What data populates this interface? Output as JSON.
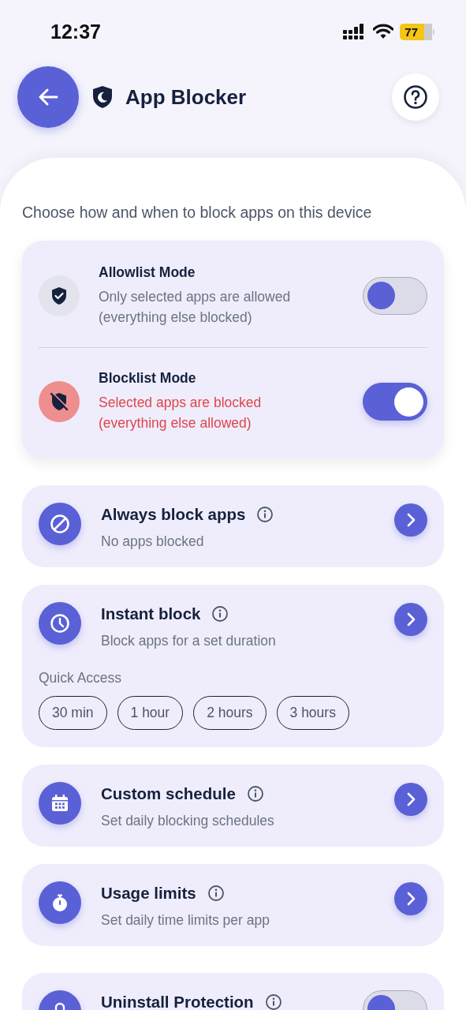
{
  "status_bar": {
    "time": "12:37",
    "battery": "77"
  },
  "header": {
    "title": "App Blocker"
  },
  "intro": "Choose how and when to block apps on this device",
  "modes": [
    {
      "kind": "allow",
      "title": "Allowlist Mode",
      "description": "Only selected apps are allowed (everything else blocked)",
      "on": false
    },
    {
      "kind": "block",
      "title": "Blocklist Mode",
      "description": "Selected apps are blocked (everything else allowed)",
      "on": true
    }
  ],
  "features": [
    {
      "kind": "link",
      "title": "Always block apps",
      "subtitle": "No apps blocked"
    },
    {
      "kind": "link",
      "title": "Instant block",
      "subtitle": "Block apps for a set duration",
      "quick_access": {
        "label": "Quick Access",
        "options": [
          "30 min",
          "1 hour",
          "2 hours",
          "3 hours"
        ]
      }
    },
    {
      "kind": "link",
      "title": "Custom schedule",
      "subtitle": "Set daily blocking schedules"
    },
    {
      "kind": "link",
      "title": "Usage limits",
      "subtitle": "Set daily time limits per app"
    },
    {
      "kind": "toggle",
      "title": "Uninstall Protection",
      "on": false
    }
  ]
}
